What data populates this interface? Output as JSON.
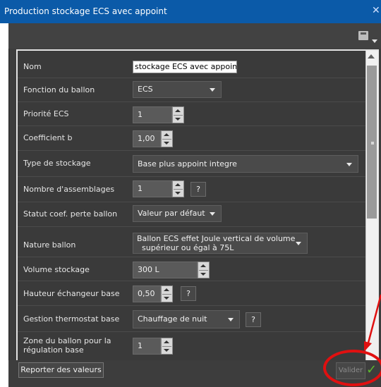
{
  "window": {
    "title": "Production stockage ECS avec appoint",
    "close_icon": "close-icon"
  },
  "toolbar": {
    "icon": "save-icon"
  },
  "form": {
    "nom_label": "Nom",
    "nom_value": "stockage ECS avec appoint",
    "fonction_label": "Fonction du ballon",
    "fonction_value": "ECS",
    "priorite_label": "Priorité ECS",
    "priorite_value": "1",
    "coef_label": "Coefficient b",
    "coef_value": "1,00",
    "type_label": "Type de stockage",
    "type_value": "Base plus appoint integre",
    "nombre_label": "Nombre d'assemblages",
    "nombre_value": "1",
    "nombre_help": "?",
    "statut_label": "Statut coef. perte ballon",
    "statut_value": "Valeur par défaut",
    "nature_label": "Nature ballon",
    "nature_value_line1": "Ballon ECS effet Joule vertical de volume",
    "nature_value_line2": "supérieur ou égal à 75L",
    "volume_label": "Volume stockage",
    "volume_value": "300 L",
    "hauteur_label": "Hauteur échangeur base",
    "hauteur_value": "0,50",
    "hauteur_help": "?",
    "gestion_label": "Gestion thermostat base",
    "gestion_value": "Chauffage de nuit",
    "gestion_help": "?",
    "zone_label_line1": "Zone du ballon pour la",
    "zone_label_line2": "régulation base",
    "zone_value": "1"
  },
  "footer": {
    "report_label": "Reporter des valeurs",
    "valider_label": "Valider",
    "check_icon": "✓"
  },
  "colors": {
    "titlebar": "#0b5aa8",
    "dialog_bg": "#3d3d3d",
    "annotation_red": "#e01010",
    "check_green": "#5cb82e"
  }
}
